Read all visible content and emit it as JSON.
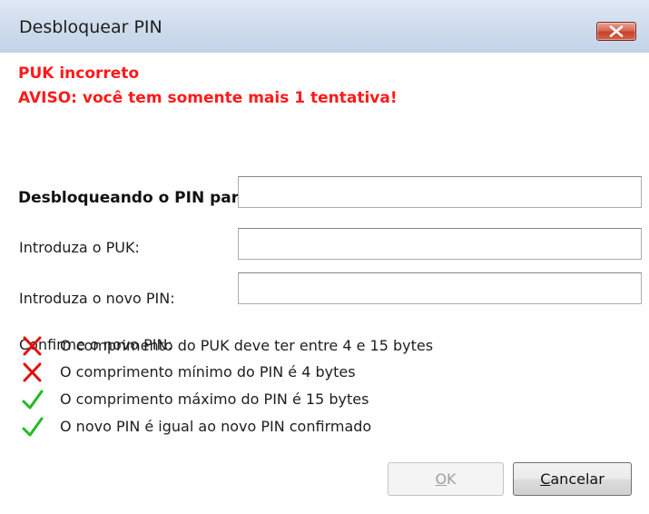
{
  "window": {
    "title": "Desbloquear PIN",
    "close_icon": "close-icon"
  },
  "errors": {
    "line1": "PUK incorreto",
    "line2": "AVISO: você tem somente mais 1 tentativa!"
  },
  "heading": "Desbloqueando o PIN para \"Certificado Prodemge\":",
  "fields": [
    {
      "label": "Introduza o PUK:",
      "value": ""
    },
    {
      "label": "Introduza o novo PIN:",
      "value": ""
    },
    {
      "label": "Confirme o novo PIN:",
      "value": ""
    }
  ],
  "checks": [
    {
      "status": "fail",
      "icon": "red-x-icon",
      "text": "O comprimento do PUK deve ter entre 4 e 15 bytes"
    },
    {
      "status": "fail",
      "icon": "red-x-icon",
      "text": "O comprimento mínimo do PIN é 4 bytes"
    },
    {
      "status": "pass",
      "icon": "green-check-icon",
      "text": "O comprimento máximo do PIN é 15 bytes"
    },
    {
      "status": "pass",
      "icon": "green-check-icon",
      "text": "O novo PIN é igual ao novo PIN confirmado"
    }
  ],
  "buttons": {
    "ok_mnemonic": "O",
    "ok_rest": "K",
    "ok_enabled": false,
    "cancel_mnemonic": "C",
    "cancel_rest": "ancelar"
  },
  "colors": {
    "error": "#ff1a1a",
    "fail_icon": "#e01010",
    "pass_icon": "#22bb22"
  }
}
